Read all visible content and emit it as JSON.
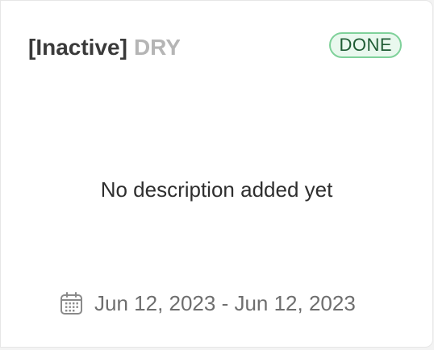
{
  "card": {
    "title_prefix": "[Inactive]",
    "title_rest": "DRY",
    "status_badge": "DONE",
    "description": "No description added yet",
    "date_range": "Jun 12, 2023 - Jun 12, 2023",
    "icons": {
      "date": "calendar-icon"
    },
    "colors": {
      "badge_border": "#7fd19a",
      "badge_background": "#e9f8ee",
      "badge_text": "#1f5c34",
      "title_prefix": "#3a3a3a",
      "title_rest": "#b5b5b5"
    }
  }
}
